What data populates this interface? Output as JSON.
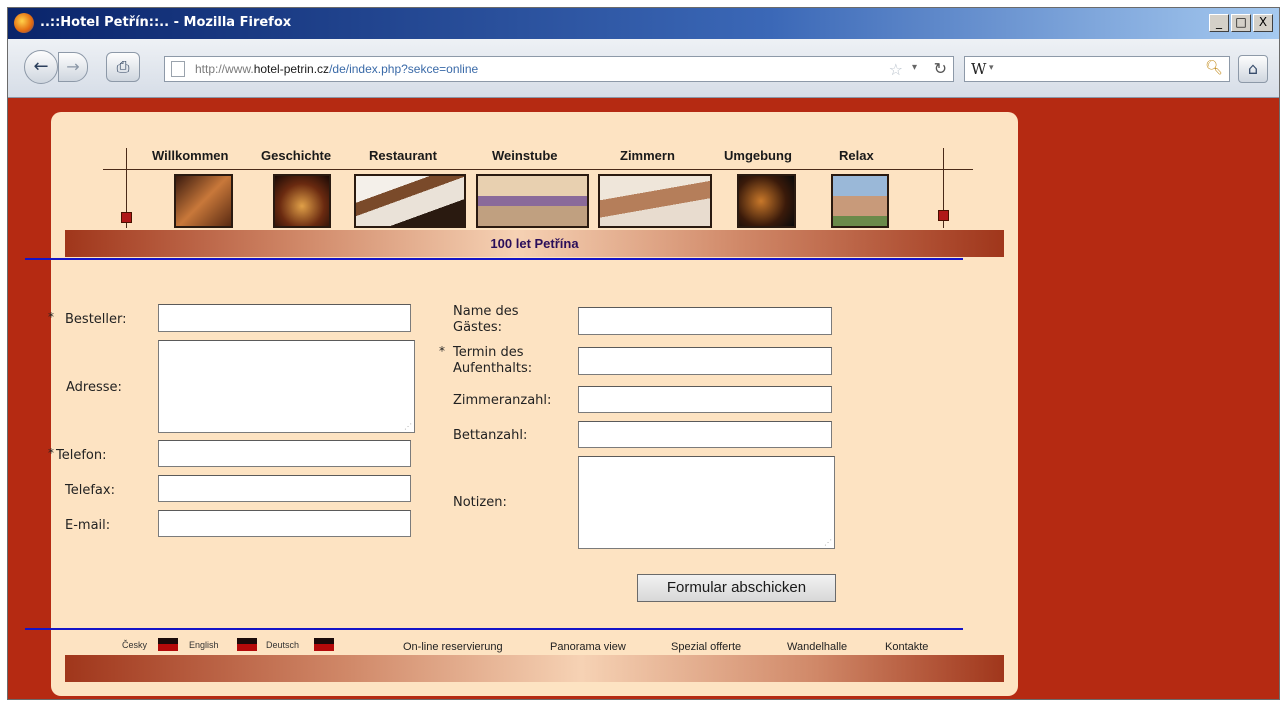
{
  "window": {
    "title": "..::Hotel Petřín::.. - Mozilla Firefox",
    "minimize": "_",
    "maximize": "□",
    "close": "X"
  },
  "navbar": {
    "url_prefix": "http://www.",
    "url_host": "hotel-petrin.cz",
    "url_path": "/de/index.php?sekce=online",
    "search_engine": "W",
    "star_icon": "star-icon",
    "home_icon": "home-icon"
  },
  "site": {
    "menu": [
      "Willkommen",
      "Geschichte",
      "Restaurant",
      "Weinstube",
      "Zimmern",
      "Umgebung",
      "Relax"
    ],
    "banner": "100 let Petřína"
  },
  "form": {
    "left": {
      "besteller": "Besteller:",
      "adresse": "Adresse:",
      "telefon": "Telefon:",
      "telefax": "Telefax:",
      "email": "E-mail:"
    },
    "right": {
      "name_line1": "Name des",
      "name_line2": "Gästes:",
      "termin_line1": "Termin des",
      "termin_line2": "Aufenthalts:",
      "zimmeranzahl": "Zimmeranzahl:",
      "bettanzahl": "Bettanzahl:",
      "notizen": "Notizen:"
    },
    "required_mark": "*",
    "submit": "Formular abschicken"
  },
  "footer": {
    "languages": [
      "Česky",
      "English",
      "Deutsch"
    ],
    "links": [
      "On-line reservierung",
      "Panorama view",
      "Spezial offerte",
      "Wandelhalle",
      "Kontakte"
    ]
  },
  "colors": {
    "page_background": "#b52a12",
    "card_background": "#fde3c2",
    "blue_line": "#1414c8",
    "banner_text": "#2a0e5a"
  }
}
